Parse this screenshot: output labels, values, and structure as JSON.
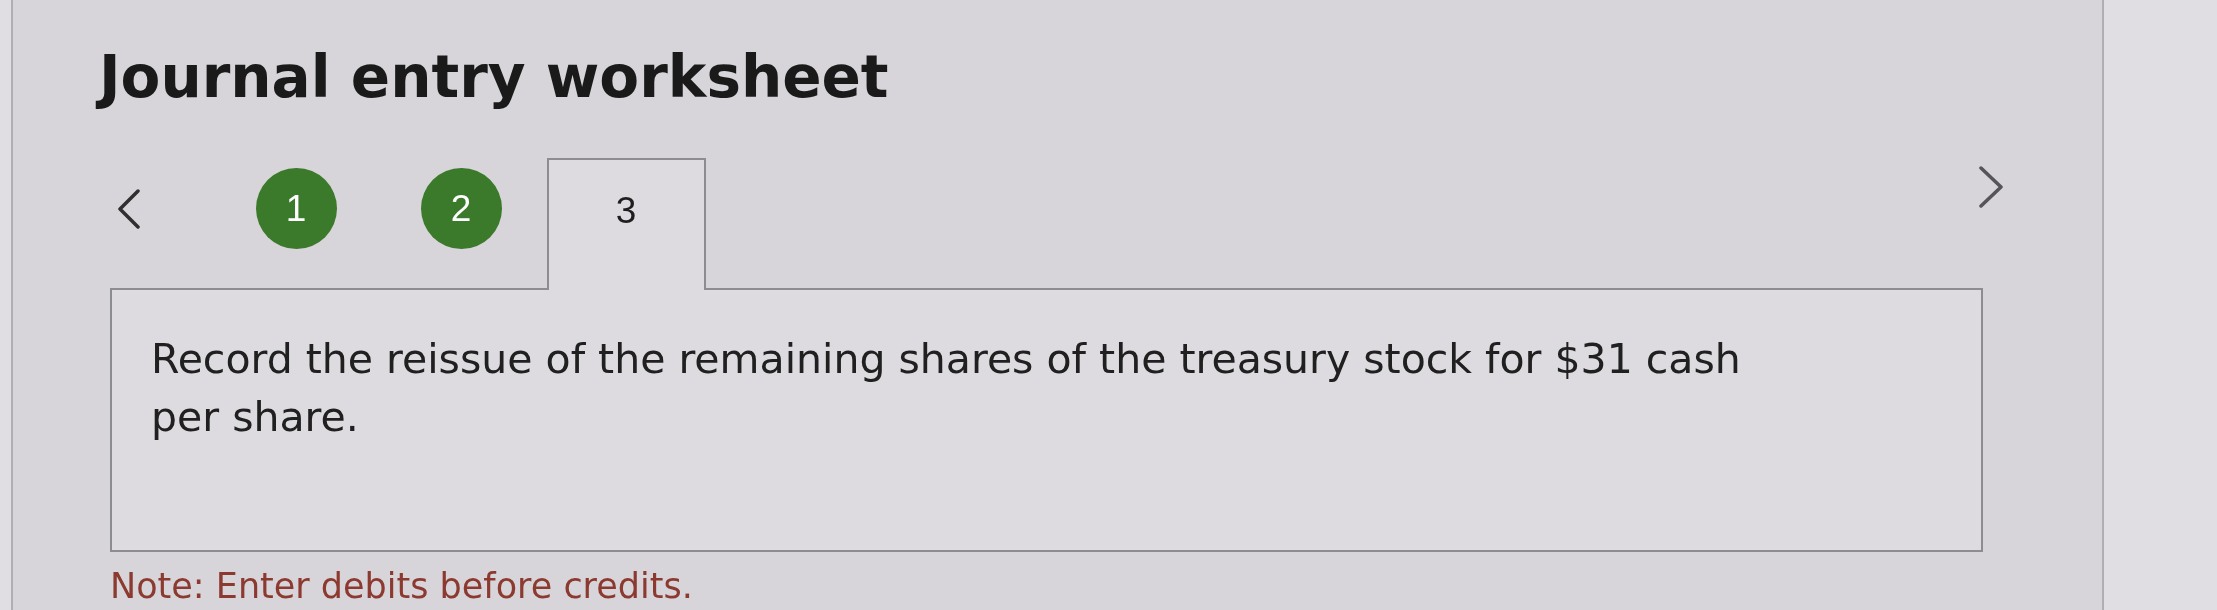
{
  "title": "Journal entry worksheet",
  "steps": [
    {
      "label": "1",
      "selected": false,
      "completed": true
    },
    {
      "label": "2",
      "selected": false,
      "completed": true
    },
    {
      "label": "3",
      "selected": true,
      "completed": false
    }
  ],
  "instruction": "Record the reissue of the remaining shares of the treasury stock for $31 cash per share.",
  "note": "Note: Enter debits before credits."
}
